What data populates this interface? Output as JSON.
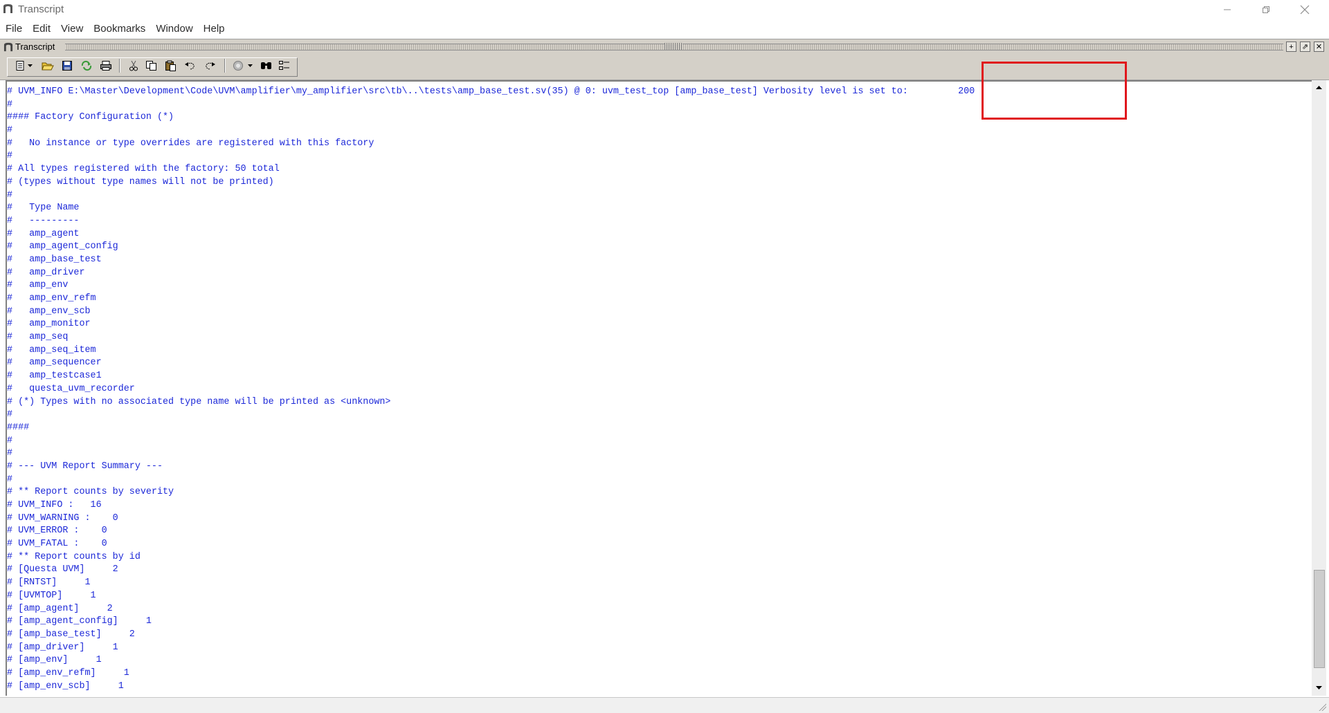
{
  "window": {
    "title": "Transcript",
    "controls": {
      "minimize": "—",
      "restore": "❐",
      "close": "✕"
    }
  },
  "menu": [
    "File",
    "Edit",
    "View",
    "Bookmarks",
    "Window",
    "Help"
  ],
  "pane": {
    "title": "Transcript",
    "buttons": [
      "+",
      "⇗",
      "✕"
    ]
  },
  "toolbar": {
    "icons": [
      "new-document-icon",
      "dropdown-arrow-icon",
      "open-folder-icon",
      "save-icon",
      "reload-icon",
      "print-icon",
      "cut-icon",
      "copy-icon",
      "paste-icon",
      "undo-icon",
      "redo-icon",
      "run-icon",
      "dropdown-arrow-icon",
      "find-icon",
      "outline-icon"
    ]
  },
  "transcript_lines": [
    "# UVM_INFO E:\\Master\\Development\\Code\\UVM\\amplifier\\my_amplifier\\src\\tb\\..\\tests\\amp_base_test.sv(35) @ 0: uvm_test_top [amp_base_test] Verbosity level is set to:         200",
    "#",
    "#### Factory Configuration (*)",
    "#",
    "#   No instance or type overrides are registered with this factory",
    "#",
    "# All types registered with the factory: 50 total",
    "# (types without type names will not be printed)",
    "#",
    "#   Type Name",
    "#   ---------",
    "#   amp_agent",
    "#   amp_agent_config",
    "#   amp_base_test",
    "#   amp_driver",
    "#   amp_env",
    "#   amp_env_refm",
    "#   amp_env_scb",
    "#   amp_monitor",
    "#   amp_seq",
    "#   amp_seq_item",
    "#   amp_sequencer",
    "#   amp_testcase1",
    "#   questa_uvm_recorder",
    "# (*) Types with no associated type name will be printed as <unknown>",
    "#",
    "####",
    "#",
    "#",
    "# --- UVM Report Summary ---",
    "#",
    "# ** Report counts by severity",
    "# UVM_INFO :   16",
    "# UVM_WARNING :    0",
    "# UVM_ERROR :    0",
    "# UVM_FATAL :    0",
    "# ** Report counts by id",
    "# [Questa UVM]     2",
    "# [RNTST]     1",
    "# [UVMTOP]     1",
    "# [amp_agent]     2",
    "# [amp_agent_config]     1",
    "# [amp_base_test]     2",
    "# [amp_driver]     1",
    "# [amp_env]     1",
    "# [amp_env_refm]     1",
    "# [amp_env_scb]     1"
  ],
  "colors": {
    "transcript_text": "#1c28d8",
    "highlight_box": "#e0161c",
    "chrome": "#d4d0c8"
  }
}
